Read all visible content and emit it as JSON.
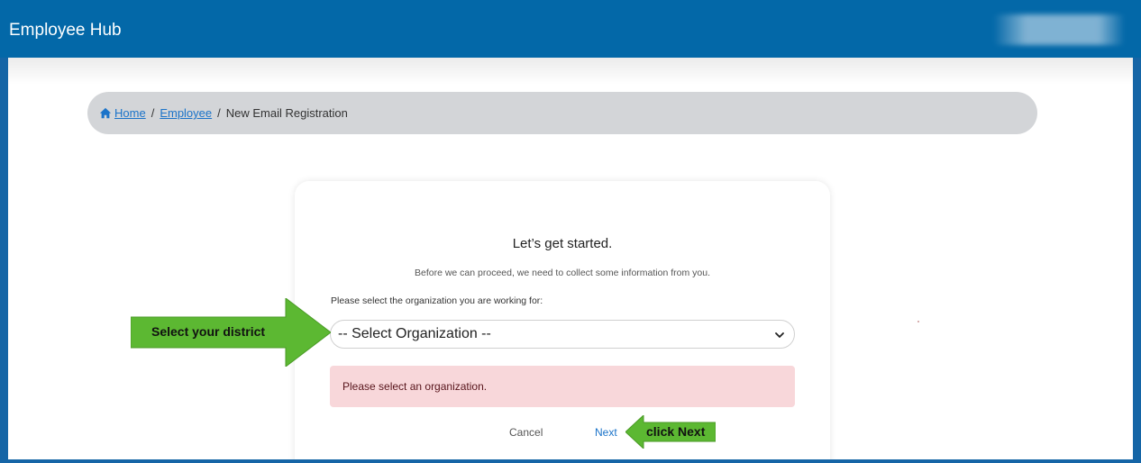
{
  "header": {
    "title": "Employee Hub"
  },
  "breadcrumb": {
    "home_icon": "home-icon",
    "home": "Home",
    "employee": "Employee",
    "current": "New Email Registration",
    "separator": "/"
  },
  "form": {
    "heading": "Let’s get started.",
    "subtext": "Before we can proceed, we need to collect some information from you.",
    "select_label": "Please select the organization you are working for:",
    "select_value": "-- Select Organization --",
    "error_message": "Please select an organization.",
    "cancel_label": "Cancel",
    "next_label": "Next"
  },
  "annotations": {
    "district_label": "Select your district",
    "next_label": "click Next",
    "arrow_color": "#5cb832"
  },
  "colors": {
    "header_bg": "#0368a8",
    "link": "#1a73c9",
    "alert_bg": "#f8d7da",
    "breadcrumb_bg": "#d3d5d8"
  }
}
